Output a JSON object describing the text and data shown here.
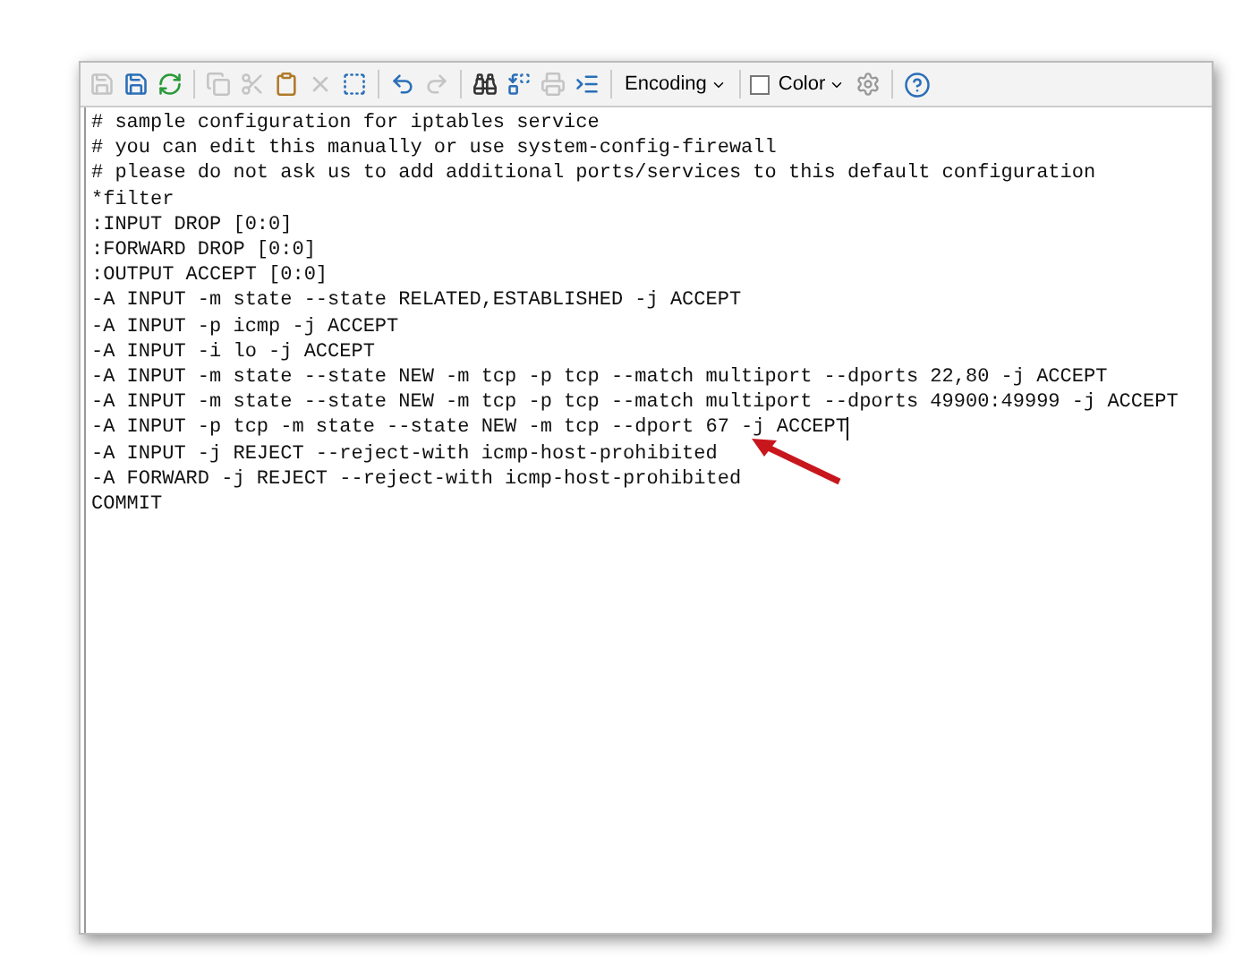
{
  "toolbar": {
    "buttons": [
      {
        "kind": "save",
        "disabled": true
      },
      {
        "kind": "save-as",
        "disabled": false
      },
      {
        "kind": "reload",
        "disabled": false
      },
      {
        "kind": "sep"
      },
      {
        "kind": "copy",
        "disabled": true
      },
      {
        "kind": "cut",
        "disabled": true
      },
      {
        "kind": "paste",
        "disabled": false
      },
      {
        "kind": "delete",
        "disabled": true
      },
      {
        "kind": "select-all",
        "disabled": false
      },
      {
        "kind": "sep"
      },
      {
        "kind": "undo",
        "disabled": false
      },
      {
        "kind": "redo",
        "disabled": true
      },
      {
        "kind": "sep"
      },
      {
        "kind": "find",
        "disabled": false
      },
      {
        "kind": "replace",
        "disabled": false
      },
      {
        "kind": "print",
        "disabled": true
      },
      {
        "kind": "indent",
        "disabled": false
      },
      {
        "kind": "sep"
      }
    ],
    "encoding": {
      "label": "Encoding"
    },
    "color": {
      "label": "Color",
      "checked": false
    }
  },
  "editor": {
    "lines": [
      {
        "text": "# sample configuration for iptables service",
        "caret": false
      },
      {
        "text": "# you can edit this manually or use system-config-firewall",
        "caret": false
      },
      {
        "text": "# please do not ask us to add additional ports/services to this default configuration",
        "caret": false
      },
      {
        "text": "*filter",
        "caret": false
      },
      {
        "text": ":INPUT DROP [0:0]",
        "caret": false
      },
      {
        "text": ":FORWARD DROP [0:0]",
        "caret": false
      },
      {
        "text": ":OUTPUT ACCEPT [0:0]",
        "caret": false
      },
      {
        "text": "-A INPUT -m state --state RELATED,ESTABLISHED -j ACCEPT",
        "caret": false
      },
      {
        "text": "-A INPUT -p icmp -j ACCEPT",
        "caret": false
      },
      {
        "text": "-A INPUT -i lo -j ACCEPT",
        "caret": false
      },
      {
        "text": "-A INPUT -m state --state NEW -m tcp -p tcp --match multiport --dports 22,80 -j ACCEPT",
        "caret": false
      },
      {
        "text": "-A INPUT -m state --state NEW -m tcp -p tcp --match multiport --dports 49900:49999 -j ACCEPT",
        "caret": false
      },
      {
        "text": "-A INPUT -p tcp -m state --state NEW -m tcp --dport 67 -j ACCEPT",
        "caret": true
      },
      {
        "text": "-A INPUT -j REJECT --reject-with icmp-host-prohibited",
        "caret": false
      },
      {
        "text": "-A FORWARD -j REJECT --reject-with icmp-host-prohibited",
        "caret": false
      },
      {
        "text": "COMMIT",
        "caret": false
      }
    ]
  }
}
